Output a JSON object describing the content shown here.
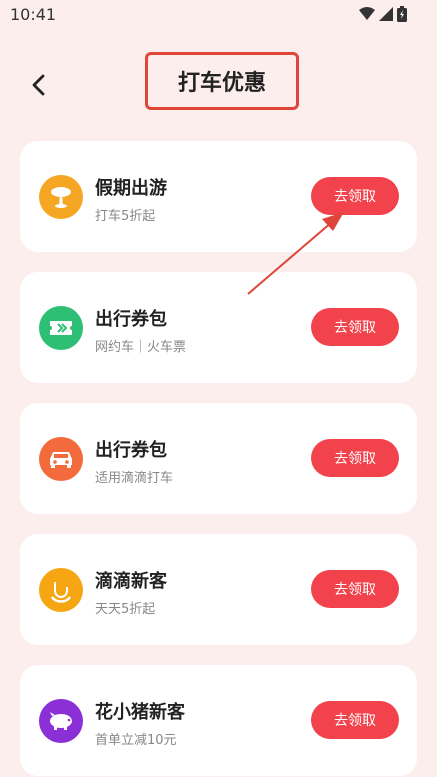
{
  "status_bar": {
    "time": "10:41"
  },
  "header": {
    "title": "打车优惠"
  },
  "colors": {
    "accent": "#f2434c",
    "annotation": "#e0453a"
  },
  "cards": [
    {
      "title": "假期出游",
      "subtitle": "打车5折起",
      "button": "去领取",
      "icon": "palm-tree-icon",
      "icon_color": "#f5a623"
    },
    {
      "title": "出行券包",
      "subtitle": "网约车｜火车票",
      "button": "去领取",
      "icon": "ticket-icon",
      "icon_color": "#2dbf74"
    },
    {
      "title": "出行券包",
      "subtitle": "适用滴滴打车",
      "button": "去领取",
      "icon": "car-icon",
      "icon_color": "#f36b3c"
    },
    {
      "title": "滴滴新客",
      "subtitle": "天天5折起",
      "button": "去领取",
      "icon": "didi-logo-icon",
      "icon_color": "#f7a613"
    },
    {
      "title": "花小猪新客",
      "subtitle": "首单立减10元",
      "button": "去领取",
      "icon": "pig-icon",
      "icon_color": "#8b2fd6"
    }
  ]
}
